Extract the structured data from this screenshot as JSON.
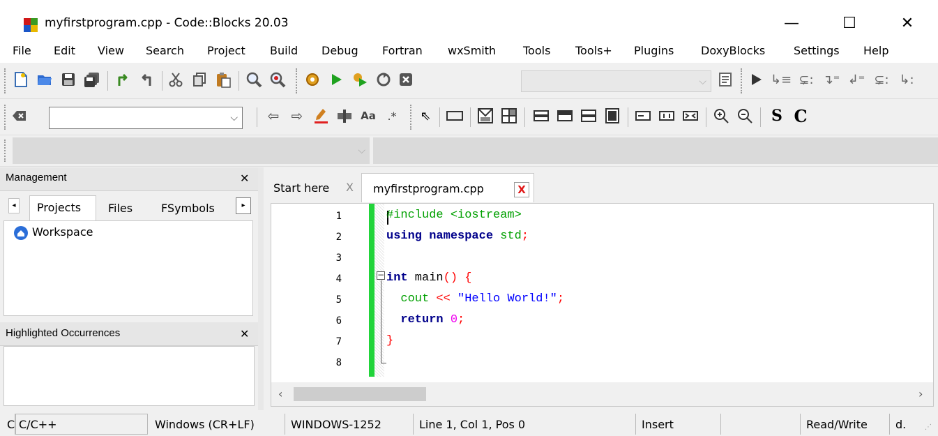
{
  "window": {
    "title": "myfirstprogram.cpp - Code::Blocks 20.03",
    "controls": {
      "minimize": "—",
      "maximize": "☐",
      "close": "✕"
    }
  },
  "menu": [
    "File",
    "Edit",
    "View",
    "Search",
    "Project",
    "Build",
    "Debug",
    "Fortran",
    "wxSmith",
    "Tools",
    "Tools+",
    "Plugins",
    "DoxyBlocks",
    "Settings",
    "Help"
  ],
  "toolbar2": {
    "search_text": ""
  },
  "management": {
    "title": "Management",
    "tabs": [
      "Projects",
      "Files",
      "FSymbols"
    ],
    "tree": [
      "Workspace"
    ]
  },
  "occurrences": {
    "title": "Highlighted Occurrences"
  },
  "editor": {
    "tabs": [
      {
        "label": "Start here",
        "close": "X"
      },
      {
        "label": "myfirstprogram.cpp",
        "close": "X"
      }
    ],
    "line_numbers": [
      "1",
      "2",
      "3",
      "4",
      "5",
      "6",
      "7",
      "8"
    ],
    "fold_marker": "−"
  },
  "status": {
    "field0": "C",
    "language": "C/C++",
    "eol": "Windows (CR+LF)",
    "encoding": "WINDOWS-1252",
    "position": "Line 1, Col 1, Pos 0",
    "mode": "Insert",
    "blank": "",
    "access": "Read/Write",
    "extra": "d."
  },
  "colors": {
    "keyword": "#00008b",
    "string": "#0000ff",
    "preprocessor": "#00a000",
    "number": "#f000f0",
    "operator": "#ff0000",
    "change_bar": "#21d43a"
  }
}
